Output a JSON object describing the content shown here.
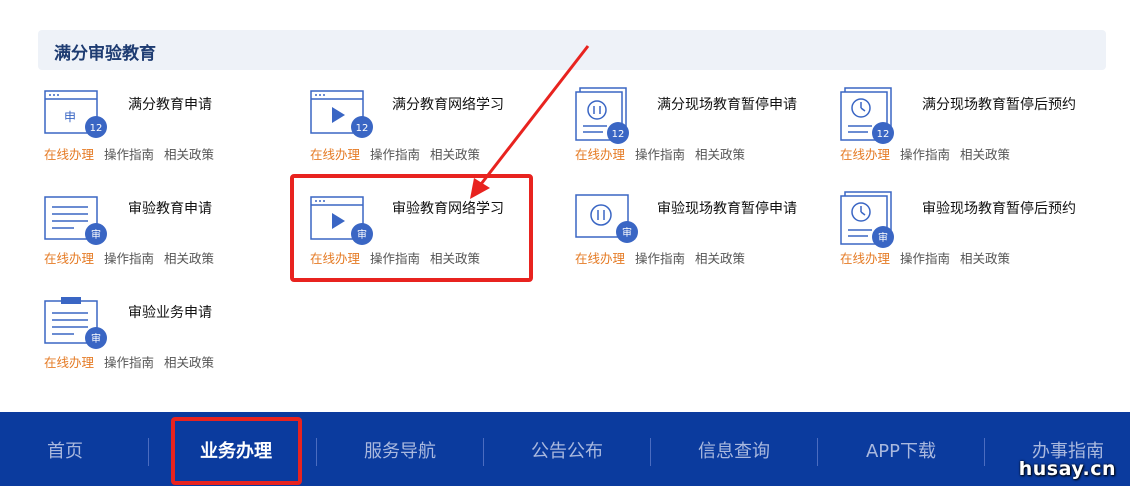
{
  "section": {
    "title": "满分审验教育"
  },
  "items": [
    {
      "title": "满分教育申请",
      "badge": "12",
      "icon": "document-apply-icon",
      "icon_text": "申"
    },
    {
      "title": "满分教育网络学习",
      "badge": "12",
      "icon": "video-play-icon"
    },
    {
      "title": "满分现场教育暂停申请",
      "badge": "12",
      "icon": "pause-doc-icon"
    },
    {
      "title": "满分现场教育暂停后预约",
      "badge": "12",
      "icon": "clock-doc-icon"
    },
    {
      "title": "审验教育申请",
      "badge": "审",
      "icon": "text-doc-icon"
    },
    {
      "title": "审验教育网络学习",
      "badge": "审",
      "icon": "video-play-icon"
    },
    {
      "title": "审验现场教育暂停申请",
      "badge": "审",
      "icon": "pause-doc-icon"
    },
    {
      "title": "审验现场教育暂停后预约",
      "badge": "审",
      "icon": "clock-doc-icon"
    },
    {
      "title": "审验业务申请",
      "badge": "审",
      "icon": "clipboard-icon"
    }
  ],
  "links": {
    "online": "在线办理",
    "guide": "操作指南",
    "policy": "相关政策"
  },
  "nav": {
    "items": [
      "首页",
      "业务办理",
      "服务导航",
      "公告公布",
      "信息查询",
      "APP下载",
      "办事指南"
    ],
    "active": "业务办理"
  },
  "watermark": "husay.cn",
  "colors": {
    "accent": "#e57b25",
    "nav_bg": "#0b3b9e",
    "icon_blue": "#3a66c4",
    "highlight": "#e8231f"
  }
}
